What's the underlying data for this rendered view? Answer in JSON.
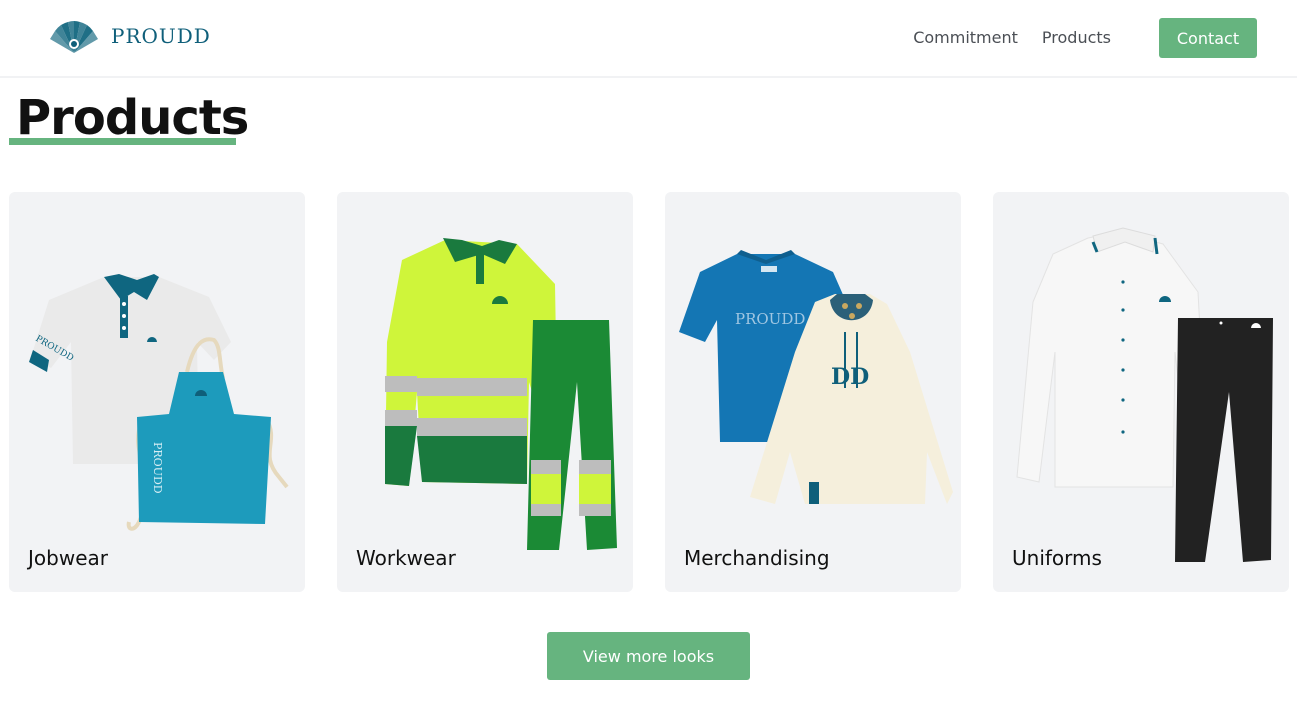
{
  "brand": {
    "name": "PROUDD",
    "logo_icon": "peacock-icon"
  },
  "nav": {
    "links": [
      "Commitment",
      "Products"
    ],
    "contact_label": "Contact"
  },
  "main": {
    "title": "Products"
  },
  "products": [
    {
      "label": "Jobwear",
      "image": "polo-apron-image"
    },
    {
      "label": "Workwear",
      "image": "hi-vis-workwear-image"
    },
    {
      "label": "Merchandising",
      "image": "tshirt-hoodie-image"
    },
    {
      "label": "Uniforms",
      "image": "shirt-trousers-image"
    }
  ],
  "image_text": {
    "polo_sleeve": "PROUDD",
    "apron": "PROUDD",
    "tshirt": "PROUDD",
    "hoodie": "DD"
  },
  "cta": {
    "label": "View more looks"
  },
  "colors": {
    "accent": "#66b47f",
    "brand": "#0f5f7a",
    "card_bg": "#f2f3f5"
  }
}
